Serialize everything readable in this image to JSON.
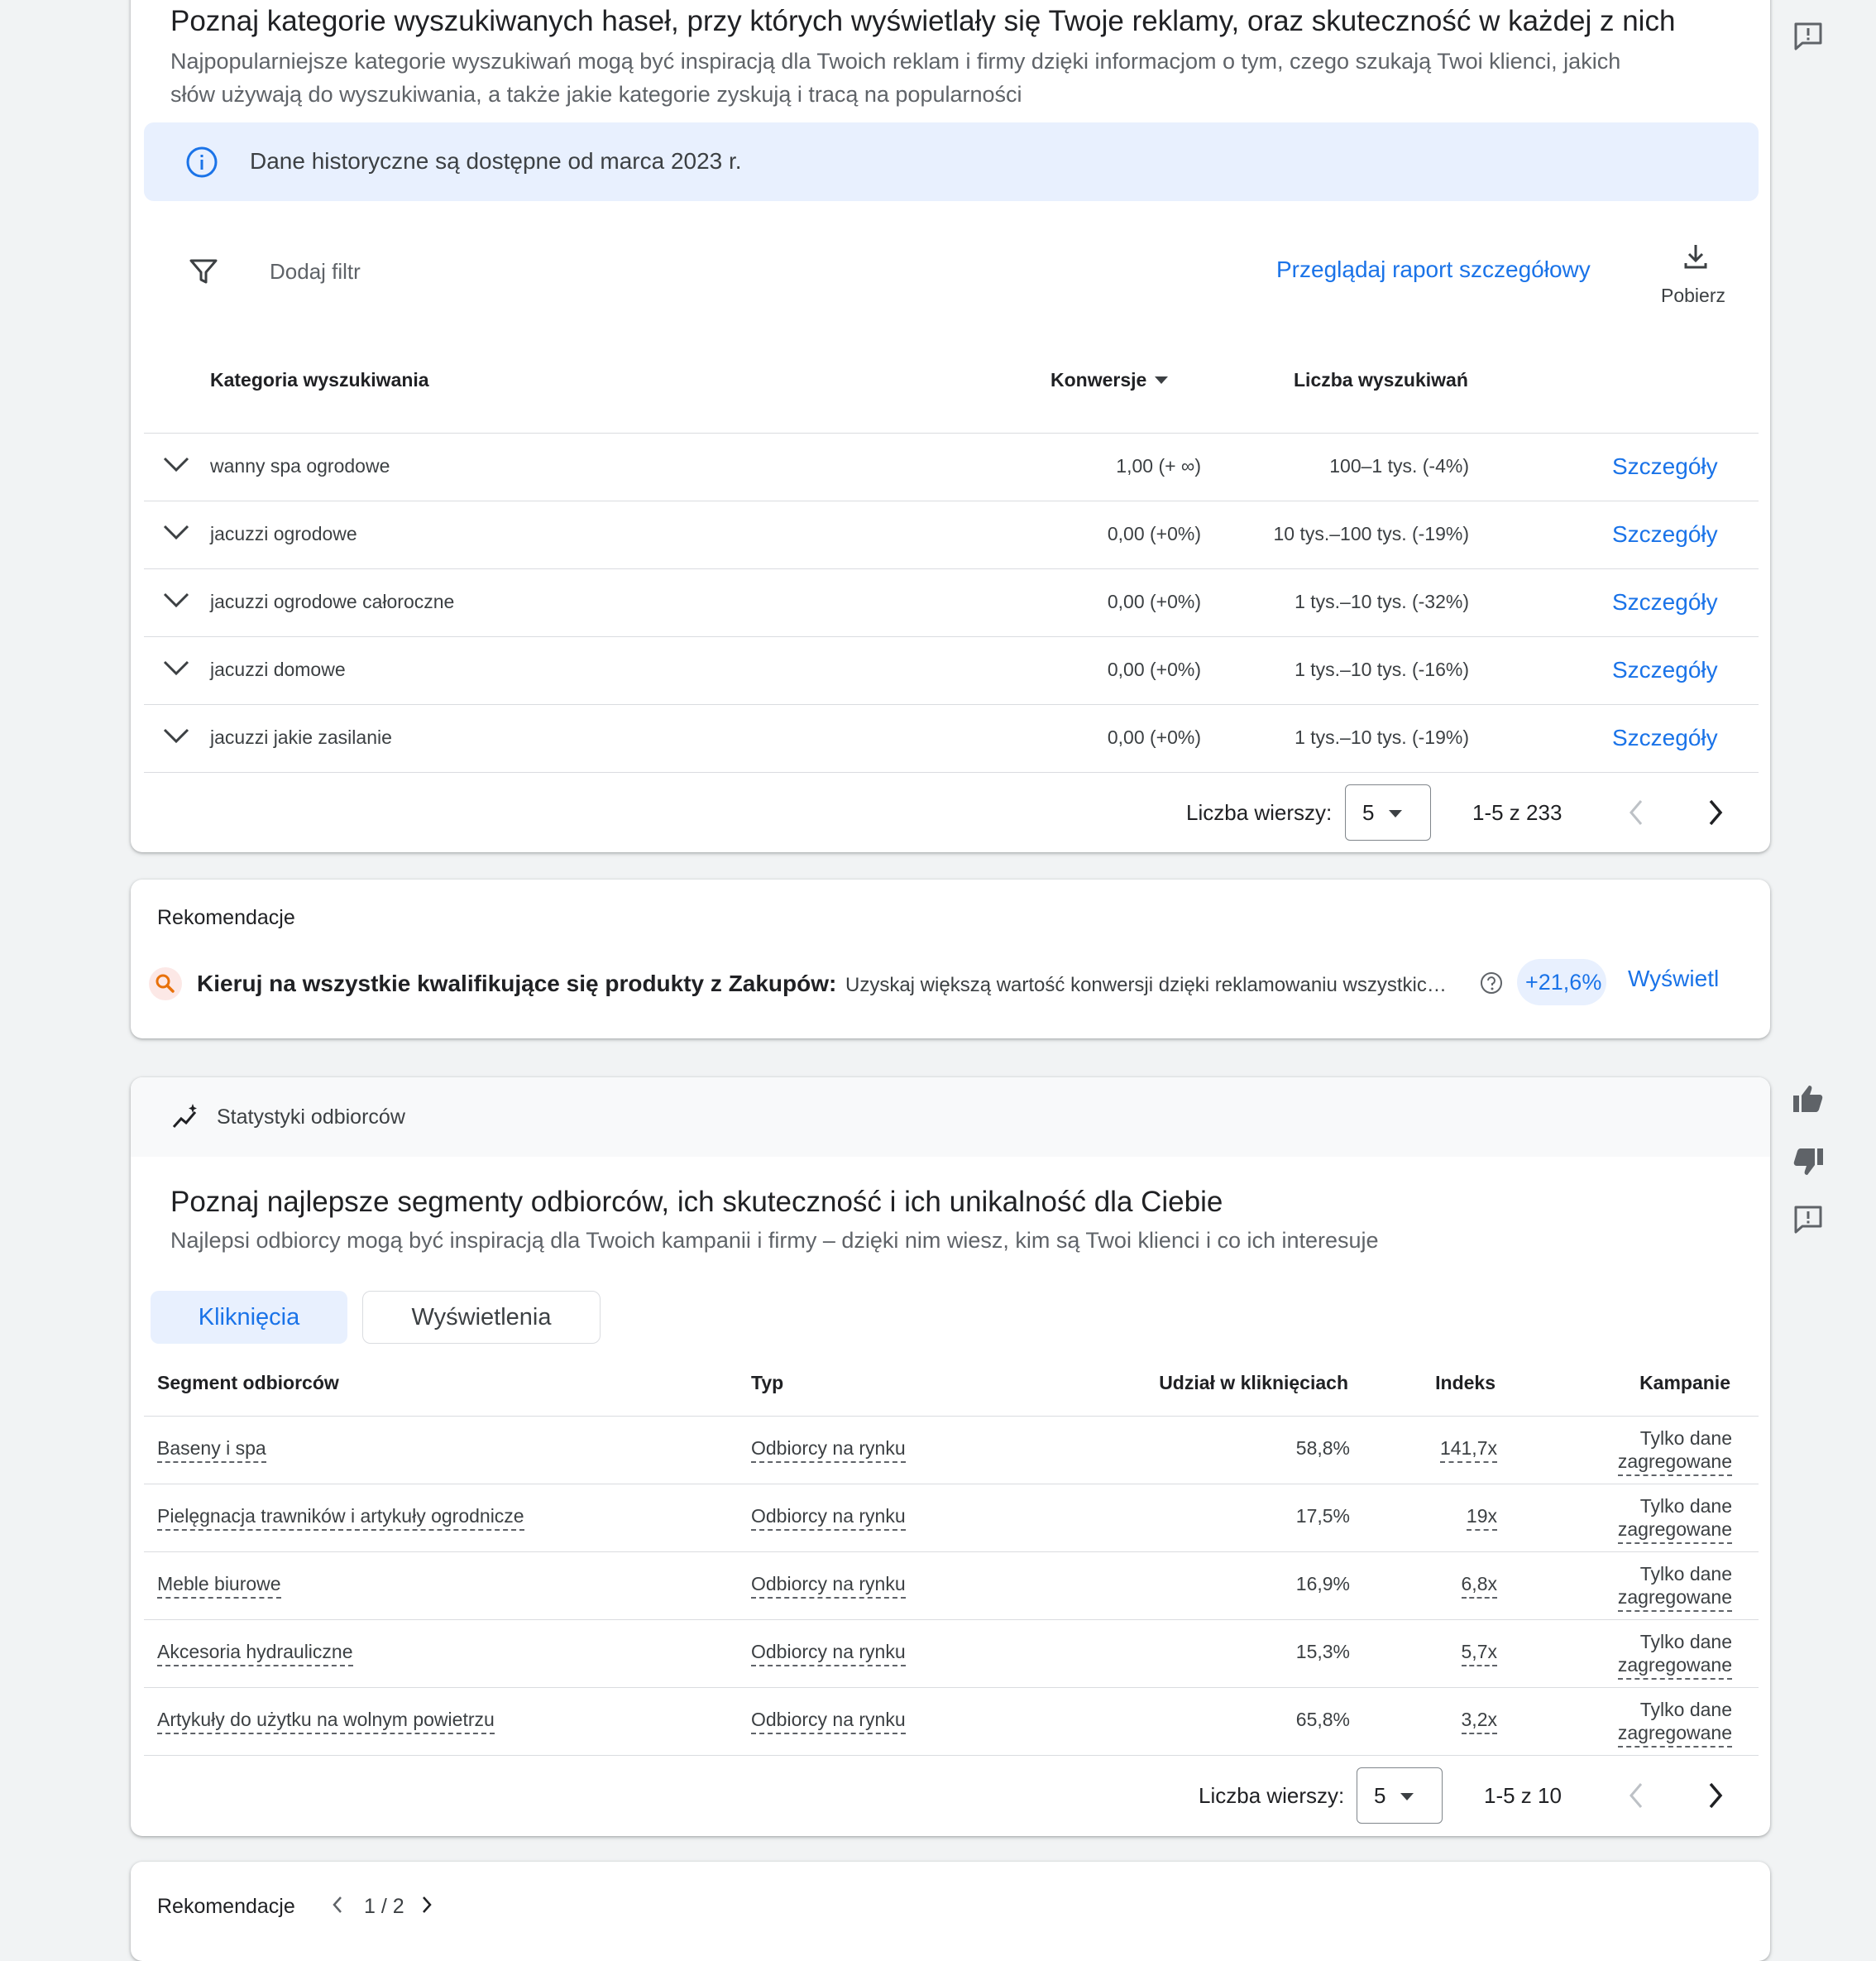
{
  "search_card": {
    "title": "Poznaj kategorie wyszukiwanych haseł, przy których wyświetlały się Twoje reklamy, oraz skuteczność w każdej z nich",
    "subtitle_line1": "Najpopularniejsze kategorie wyszukiwań mogą być inspiracją dla Twoich reklam i firmy dzięki informacjom o tym, czego szukają Twoi klienci, jakich",
    "subtitle_line2": "słów używają do wyszukiwania, a także jakie kategorie zyskują i tracą na popularności",
    "info_banner": "Dane historyczne są dostępne od marca 2023 r.",
    "add_filter": "Dodaj filtr",
    "detailed_report": "Przeglądaj raport szczegółowy",
    "download": "Pobierz",
    "columns": {
      "category": "Kategoria wyszukiwania",
      "conversions": "Konwersje",
      "searches": "Liczba wyszukiwań"
    },
    "rows": [
      {
        "category": "wanny spa ogrodowe",
        "conversions": "1,00 (+ ∞)",
        "searches": "100–1 tys. (-4%)",
        "action": "Szczegóły"
      },
      {
        "category": "jacuzzi ogrodowe",
        "conversions": "0,00 (+0%)",
        "searches": "10 tys.–100 tys. (-19%)",
        "action": "Szczegóły"
      },
      {
        "category": "jacuzzi ogrodowe całoroczne",
        "conversions": "0,00 (+0%)",
        "searches": "1 tys.–10 tys. (-32%)",
        "action": "Szczegóły"
      },
      {
        "category": "jacuzzi domowe",
        "conversions": "0,00 (+0%)",
        "searches": "1 tys.–10 tys. (-16%)",
        "action": "Szczegóły"
      },
      {
        "category": "jacuzzi jakie zasilanie",
        "conversions": "0,00 (+0%)",
        "searches": "1 tys.–10 tys. (-19%)",
        "action": "Szczegóły"
      }
    ],
    "pagination": {
      "rows_label": "Liczba wierszy:",
      "rows_value": "5",
      "range": "1-5 z 233"
    }
  },
  "recommendation_card": {
    "heading": "Rekomendacje",
    "title": "Kieruj na wszystkie kwalifikujące się produkty z Zakupów:",
    "description": "Uzyskaj większą wartość konwersji dzięki reklamowaniu wszystkic…",
    "uplift": "+21,6%",
    "action": "Wyświetl"
  },
  "audience_card": {
    "header": "Statystyki odbiorców",
    "title": "Poznaj najlepsze segmenty odbiorców, ich skuteczność i ich unikalność dla Ciebie",
    "subtitle": "Najlepsi odbiorcy mogą być inspiracją dla Twoich kampanii i firmy – dzięki nim wiesz, kim są Twoi klienci i co ich interesuje",
    "tabs": {
      "clicks": "Kliknięcia",
      "impressions": "Wyświetlenia"
    },
    "columns": {
      "segment": "Segment odbiorców",
      "type": "Typ",
      "share": "Udział w kliknięciach",
      "index": "Indeks",
      "campaigns": "Kampanie"
    },
    "rows": [
      {
        "segment": "Baseny i spa",
        "type": "Odbiorcy na rynku",
        "share": "58,8%",
        "index": "141,7x",
        "campaigns_line1": "Tylko dane",
        "campaigns_line2": "zagregowane"
      },
      {
        "segment": "Pielęgnacja trawników i artykuły ogrodnicze",
        "type": "Odbiorcy na rynku",
        "share": "17,5%",
        "index": "19x",
        "campaigns_line1": "Tylko dane",
        "campaigns_line2": "zagregowane"
      },
      {
        "segment": "Meble biurowe",
        "type": "Odbiorcy na rynku",
        "share": "16,9%",
        "index": "6,8x",
        "campaigns_line1": "Tylko dane",
        "campaigns_line2": "zagregowane"
      },
      {
        "segment": "Akcesoria hydrauliczne",
        "type": "Odbiorcy na rynku",
        "share": "15,3%",
        "index": "5,7x",
        "campaigns_line1": "Tylko dane",
        "campaigns_line2": "zagregowane"
      },
      {
        "segment": "Artykuły do użytku na wolnym powietrzu",
        "type": "Odbiorcy na rynku",
        "share": "65,8%",
        "index": "3,2x",
        "campaigns_line1": "Tylko dane",
        "campaigns_line2": "zagregowane"
      }
    ],
    "pagination": {
      "rows_label": "Liczba wierszy:",
      "rows_value": "5",
      "range": "1-5 z 10"
    }
  },
  "bottom_card": {
    "heading": "Rekomendacje",
    "pager": "1 / 2"
  },
  "colors": {
    "accent": "#1a73e8",
    "banner": "#e8f0fe",
    "page_bg": "#f1f3f4",
    "chip_bg": "#e8f0fe",
    "search_icon_bg": "#fce8e6"
  }
}
